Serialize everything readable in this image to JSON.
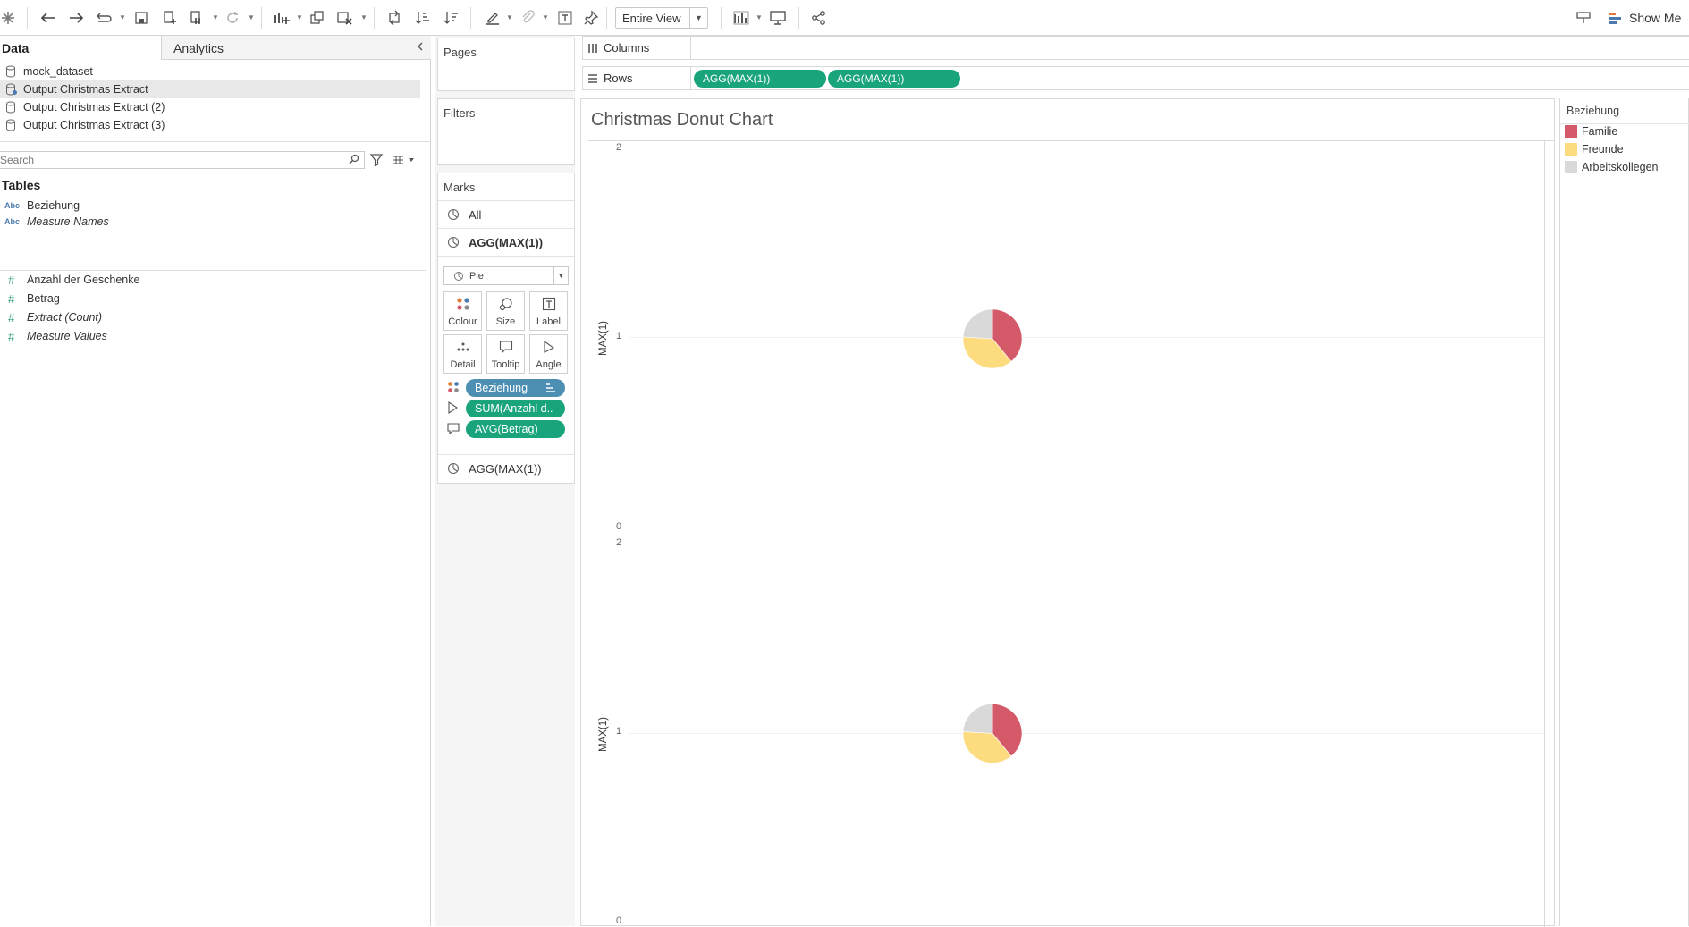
{
  "toolbar": {
    "view_select": "Entire View",
    "show_me": "Show Me",
    "icons": [
      "tableau-logo-icon",
      "undo-icon",
      "redo-icon",
      "replay-icon",
      "save-icon",
      "new-datasource-icon",
      "pause-updates-icon",
      "refresh-icon",
      "new-worksheet-icon",
      "duplicate-sheet-icon",
      "clear-sheet-icon",
      "swap-icon",
      "sort-asc-icon",
      "sort-desc-icon",
      "highlight-icon",
      "group-icon",
      "text-label-icon",
      "pin-icon",
      "fit-icon",
      "presentation-icon",
      "share-icon",
      "tooltip-pin-icon",
      "show-me-icon"
    ]
  },
  "data_pane": {
    "tab_data": "Data",
    "tab_analytics": "Analytics",
    "datasources": [
      {
        "label": "mock_dataset",
        "selected": false
      },
      {
        "label": "Output Christmas Extract",
        "selected": true
      },
      {
        "label": "Output Christmas Extract (2)",
        "selected": false
      },
      {
        "label": "Output Christmas Extract (3)",
        "selected": false
      }
    ],
    "search_placeholder": "Search",
    "tables_heading": "Tables",
    "dimensions": [
      {
        "type": "Abc",
        "label": "Beziehung",
        "italic": false
      },
      {
        "type": "Abc",
        "label": "Measure Names",
        "italic": true
      }
    ],
    "measures": [
      {
        "type": "#",
        "label": "Anzahl der Geschenke",
        "italic": false
      },
      {
        "type": "#",
        "label": "Betrag",
        "italic": false
      },
      {
        "type": "#",
        "label": "Extract (Count)",
        "italic": true
      },
      {
        "type": "#",
        "label": "Measure Values",
        "italic": true
      }
    ]
  },
  "cards": {
    "pages": "Pages",
    "filters": "Filters",
    "marks": "Marks",
    "marks_all": "All",
    "marks_layer1": "AGG(MAX(1))",
    "marks_layer2": "AGG(MAX(1))",
    "mark_type": "Pie",
    "buttons": {
      "colour": "Colour",
      "size": "Size",
      "label": "Label",
      "detail": "Detail",
      "tooltip": "Tooltip",
      "angle": "Angle"
    },
    "pills": {
      "colour": "Beziehung",
      "angle": "SUM(Anzahl d..",
      "tooltip": "AVG(Betrag)"
    }
  },
  "shelves": {
    "columns": "Columns",
    "rows": "Rows",
    "row_pills": [
      "AGG(MAX(1))",
      "AGG(MAX(1))"
    ]
  },
  "viz": {
    "title": "Christmas Donut Chart",
    "top_pane": {
      "ylabel": "MAX(1)",
      "ticks": [
        "2",
        "1",
        "0"
      ]
    },
    "bottom_pane": {
      "ylabel": "MAX(1)",
      "ticks": [
        "2",
        "1",
        "0"
      ]
    }
  },
  "legend": {
    "title": "Beziehung",
    "items": [
      {
        "label": "Familie",
        "color": "#d45a6a"
      },
      {
        "label": "Freunde",
        "color": "#fcdc7f"
      },
      {
        "label": "Arbeitskollegen",
        "color": "#d9d9d9"
      }
    ]
  },
  "chart_data": [
    {
      "type": "pie",
      "ylabel": "MAX(1)",
      "ylim": [
        0,
        2
      ],
      "categories": [
        "Familie",
        "Freunde",
        "Arbeitskollegen"
      ],
      "values": [
        0.39,
        0.37,
        0.24
      ],
      "y_position": 1
    },
    {
      "type": "pie",
      "ylabel": "MAX(1)",
      "ylim": [
        0,
        2
      ],
      "categories": [
        "Familie",
        "Freunde",
        "Arbeitskollegen"
      ],
      "values": [
        0.39,
        0.37,
        0.24
      ],
      "y_position": 1
    }
  ]
}
